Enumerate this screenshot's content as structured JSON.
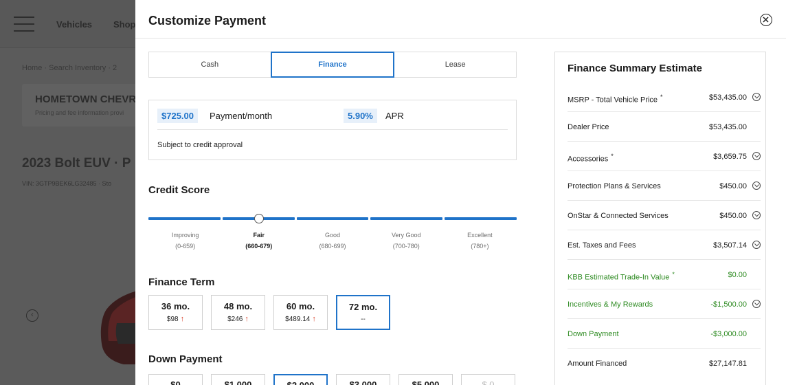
{
  "background": {
    "nav_links": [
      "Vehicles",
      "Shop"
    ],
    "breadcrumb": "Home · Search Inventory · 2",
    "dealer_name": "HOMETOWN CHEVR",
    "dealer_sub": "Pricing and fee information provi",
    "vehicle_title": "2023 Bolt EUV · P",
    "vin": "VIN: 3GTP9BEK6LG32485 · Sto"
  },
  "modal": {
    "title": "Customize Payment"
  },
  "tabs": [
    {
      "label": "Cash",
      "active": false
    },
    {
      "label": "Finance",
      "active": true
    },
    {
      "label": "Lease",
      "active": false
    }
  ],
  "payment": {
    "monthly_value": "$725.00",
    "monthly_label": "Payment/month",
    "apr_value": "5.90%",
    "apr_label": "APR",
    "note": "Subject to credit approval"
  },
  "credit": {
    "title": "Credit Score",
    "levels": [
      {
        "name": "Improving",
        "range": "(0-659)"
      },
      {
        "name": "Fair",
        "range": "(660-679)"
      },
      {
        "name": "Good",
        "range": "(680-699)"
      },
      {
        "name": "Very Good",
        "range": "(700-780)"
      },
      {
        "name": "Excellent",
        "range": "(780+)"
      }
    ],
    "selected_index": 1
  },
  "term": {
    "title": "Finance Term",
    "options": [
      {
        "label": "36 mo.",
        "sub": "$98",
        "up": true
      },
      {
        "label": "48 mo.",
        "sub": "$246",
        "up": true
      },
      {
        "label": "60 mo.",
        "sub": "$489.14",
        "up": true
      },
      {
        "label": "72 mo.",
        "sub": "--",
        "up": false
      }
    ],
    "selected_index": 3
  },
  "down_payment": {
    "title": "Down Payment",
    "options": [
      "$0",
      "$1,000",
      "$2,000",
      "$3,000",
      "$5,000",
      "$ 0"
    ],
    "selected_index": 2
  },
  "summary": {
    "title": "Finance Summary Estimate",
    "rows": [
      {
        "label": "MSRP - Total Vehicle Price",
        "sup": "*",
        "value": "$53,435.00",
        "chevron": true,
        "green": false
      },
      {
        "label": "Dealer Price",
        "sup": "",
        "value": "$53,435.00",
        "chevron": false,
        "green": false
      },
      {
        "label": "Accessories",
        "sup": "*",
        "value": "$3,659.75",
        "chevron": true,
        "green": false
      },
      {
        "label": "Protection Plans & Services",
        "sup": "",
        "value": "$450.00",
        "chevron": true,
        "green": false
      },
      {
        "label": "OnStar & Connected Services",
        "sup": "",
        "value": "$450.00",
        "chevron": true,
        "green": false
      },
      {
        "label": "Est. Taxes and Fees",
        "sup": "",
        "value": "$3,507.14",
        "chevron": true,
        "green": false
      },
      {
        "label": "KBB Estimated Trade-In Value",
        "sup": "*",
        "value": "$0.00",
        "chevron": false,
        "green": true
      },
      {
        "label": "Incentives & My Rewards",
        "sup": "",
        "value": "-$1,500.00",
        "chevron": true,
        "green": true
      },
      {
        "label": "Down Payment",
        "sup": "",
        "value": "-$3,000.00",
        "chevron": false,
        "green": true
      },
      {
        "label": "Amount Financed",
        "sup": "",
        "value": "$27,147.81",
        "chevron": false,
        "green": false
      }
    ]
  },
  "colors": {
    "accent": "#1f73c9",
    "green": "#2e8b22",
    "price_up": "#d9412b"
  }
}
